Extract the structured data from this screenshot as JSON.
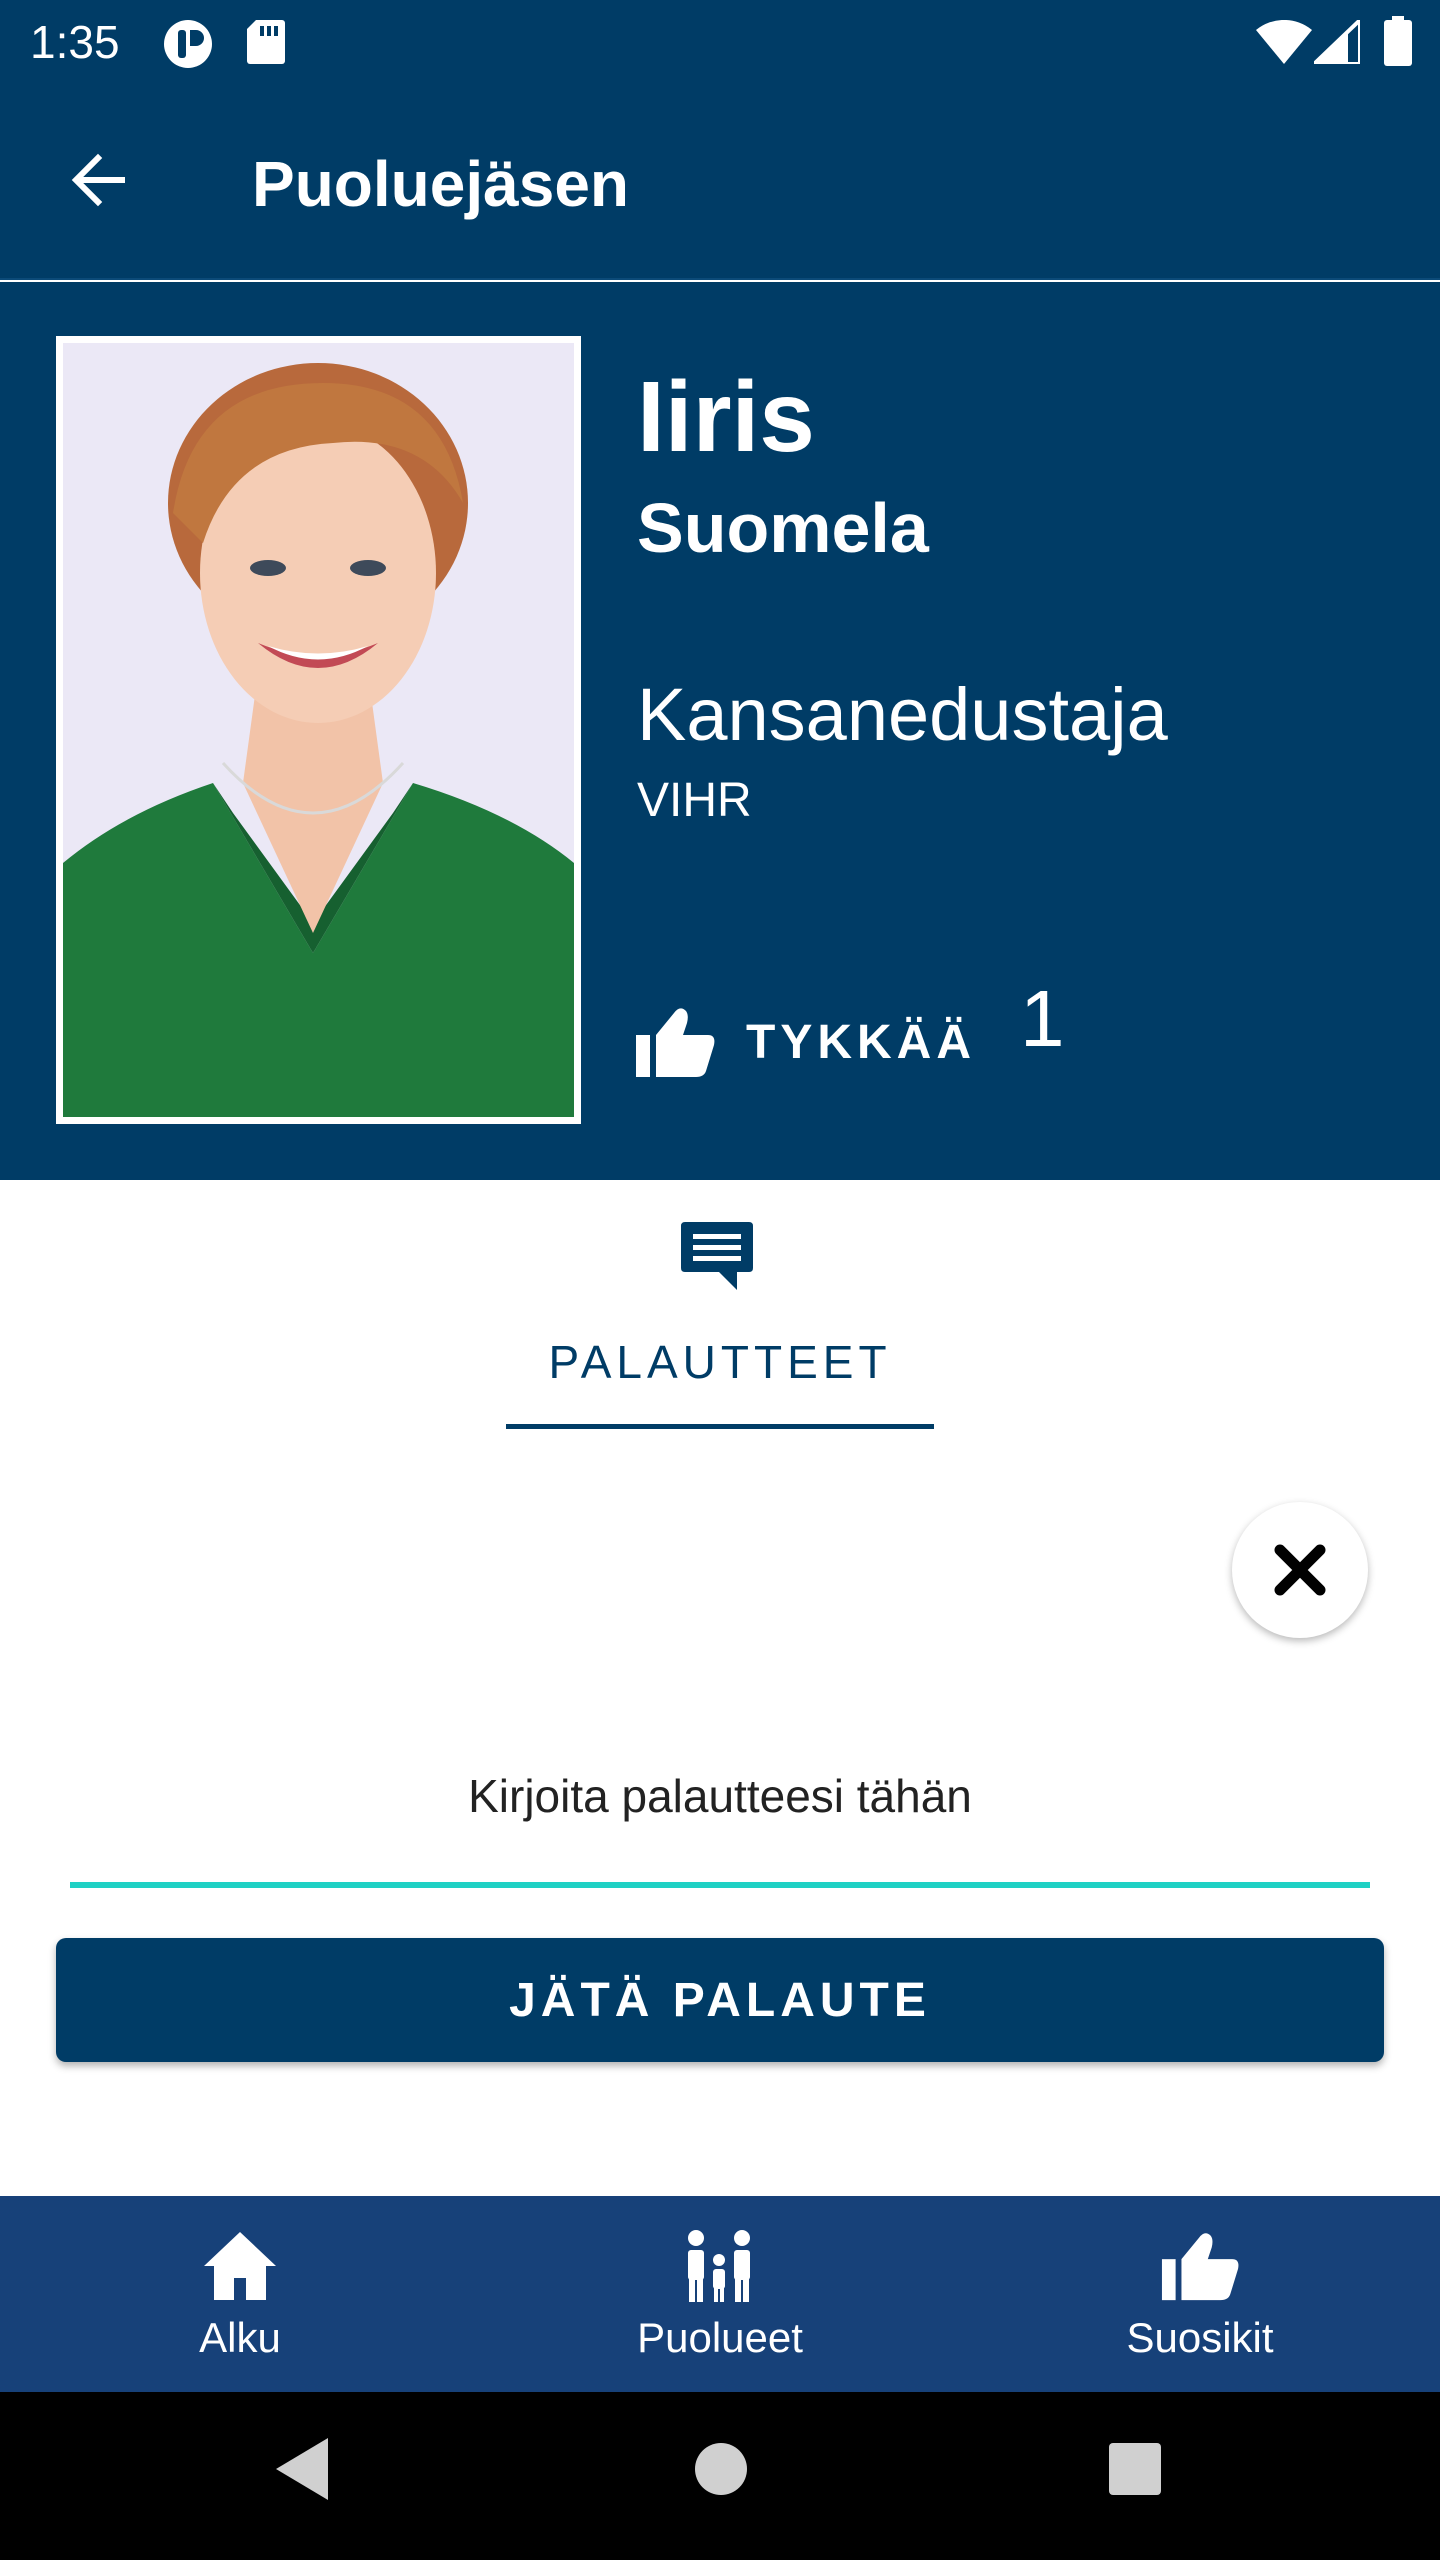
{
  "status_bar": {
    "time": "1:35",
    "icons": [
      "app-notification-icon",
      "sd-card-icon",
      "wifi-icon",
      "signal-icon",
      "battery-icon"
    ]
  },
  "app_bar": {
    "title": "Puoluejäsen",
    "back_icon": "arrow-back-icon"
  },
  "profile": {
    "first_name": "Iiris",
    "last_name": "Suomela",
    "role": "Kansanedustaja",
    "party": "VIHR",
    "like_label": "TYKKÄÄ",
    "like_icon": "thumb-up-icon",
    "like_count": "1"
  },
  "tabs": [
    {
      "label": "PALAUTTEET",
      "icon": "comment-icon",
      "selected": true
    }
  ],
  "feedback": {
    "close_icon": "close-icon",
    "input_placeholder": "Kirjoita palautteesi tähän",
    "submit_label": "JÄTÄ PALAUTE"
  },
  "bottom_nav": {
    "items": [
      {
        "label": "Alku",
        "icon": "home-icon"
      },
      {
        "label": "Puolueet",
        "icon": "people-icon"
      },
      {
        "label": "Suosikit",
        "icon": "thumb-up-icon"
      }
    ]
  },
  "system_nav": {
    "buttons": [
      "back-triangle-icon",
      "home-circle-icon",
      "recents-square-icon"
    ]
  },
  "colors": {
    "primary": "#003c66",
    "bottom_nav": "#174179",
    "accent": "#1fd1c4"
  }
}
